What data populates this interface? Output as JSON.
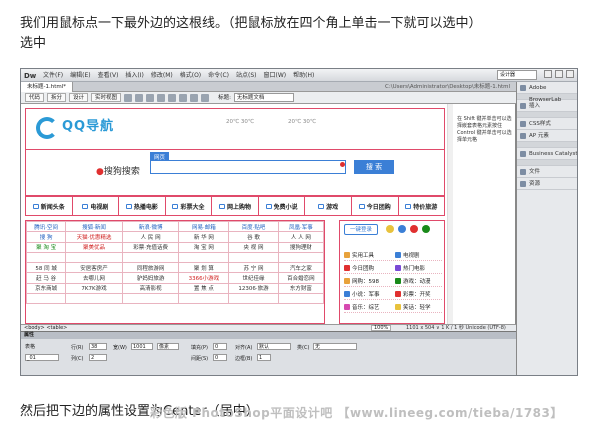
{
  "article": {
    "line1": "我们用鼠标点一下最外边的这根线。（把鼠标放在四个角上单击一下就可以选中）",
    "line2": "选中",
    "line3": "然后把下边的属性设置为Center（居中）"
  },
  "watermark": "彩色版 PhotoShop平面设计吧 【www.lineeg.com/tieba/1783】",
  "dw": {
    "logo": "Dw",
    "menu": [
      "文件(F)",
      "编辑(E)",
      "查看(V)",
      "插入(I)",
      "修改(M)",
      "格式(O)",
      "命令(C)",
      "站点(S)",
      "窗口(W)",
      "帮助(H)"
    ],
    "workspace": "设计器",
    "doc_tab": "未标题-1.html*",
    "doc_path": "C:\\Users\\Administrator\\Desktop\\未标题-1.html",
    "views": [
      "代码",
      "拆分",
      "设计",
      "实时视图"
    ],
    "title_label": "标题:",
    "title_value": "无标题文档",
    "tooltip": "在 Shift 键并单击可以选择嵌套表格元素按住 Control 键并单击可以选择单元格"
  },
  "page": {
    "logo_text": "QQ导航",
    "weather1": "20℃ 30℃",
    "weather2": "20℃ 30℃",
    "search_logo": "搜狗搜索",
    "search_tab": "网页",
    "search_button": "搜 索",
    "nav": [
      "新闻头条",
      "电视剧",
      "热播电影",
      "彩票大全",
      "网上购物",
      "免费小说",
      "游戏",
      "今日团购",
      "特价旅游"
    ],
    "grid": [
      [
        "腾讯·空间",
        "搜狐·新闻",
        "新浪·微博",
        "网易·邮箱",
        "百度·贴吧",
        "凤凰·军事"
      ],
      [
        "搜 狗",
        "天猫·优惠精选",
        "人 民 网",
        "新 华 网",
        "谷 歌",
        "人 人 网"
      ],
      [
        "聚 淘 宝",
        "聚美优品",
        "彩票·充值话费",
        "淘 宝 网",
        "央 视 网",
        "搜狗理财"
      ],
      [
        "",
        "",
        "",
        "",
        "",
        ""
      ],
      [
        "58 同 城",
        "安居客房产",
        "同程旅游网",
        "聚 划 算",
        "苏 宁 网",
        "汽车之家"
      ],
      [
        "赶 马 谷",
        "去哪儿网",
        "驴妈妈旅游",
        "3366小游戏",
        "世纪佳缘",
        "百合婚恋网"
      ],
      [
        "京东商城",
        "7K7K游戏",
        "高清影视",
        "置 焦 点",
        "12306·旅游",
        "东方财富"
      ],
      [
        "",
        "",
        "",
        "",
        "",
        ""
      ]
    ],
    "side_btn": "一键登录",
    "side_rows": [
      [
        "实用工具",
        "电视剧"
      ],
      [
        "今日团购",
        "热门电影"
      ],
      [
        "网购：598",
        "游戏：动漫"
      ],
      [
        "小说：军事",
        "彩票：开奖"
      ],
      [
        "音乐：综艺",
        "笑话：轻学"
      ]
    ]
  },
  "status": {
    "left": "<body> <table>",
    "zoom": "100%",
    "right": "1101 x 504 ∨ 1 K / 1 秒 Unicode (UTF-8)"
  },
  "props": {
    "header": "属性",
    "table_label": "表格",
    "rows_label": "行(R)",
    "rows": "38",
    "cols_label": "列(C)",
    "cols": "2",
    "width_label": "宽(W)",
    "width": "1001",
    "unit": "像素",
    "fill_label": "填充(P)",
    "fill": "0",
    "space_label": "间距(S)",
    "space": "0",
    "align_label": "对齐(A)",
    "align": "默认",
    "border_label": "边框(B)",
    "border": "1",
    "class_label": "类(C)",
    "class": "无",
    "id_value": "_01"
  },
  "panel": [
    "Adobe BrowserLab",
    "插入",
    "CSS样式",
    "AP 元素",
    "Business Catalyst",
    "文件",
    "资源"
  ],
  "colors": {
    "accent": "#3b7fd6",
    "table_border": "#e04a6a"
  }
}
